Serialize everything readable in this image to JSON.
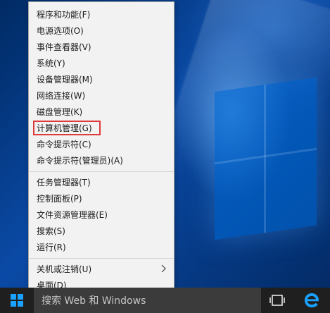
{
  "menu": {
    "items": [
      {
        "label": "程序和功能(F)"
      },
      {
        "label": "电源选项(O)"
      },
      {
        "label": "事件查看器(V)"
      },
      {
        "label": "系统(Y)"
      },
      {
        "label": "设备管理器(M)"
      },
      {
        "label": "网络连接(W)"
      },
      {
        "label": "磁盘管理(K)"
      },
      {
        "label": "计算机管理(G)"
      },
      {
        "label": "命令提示符(C)"
      },
      {
        "label": "命令提示符(管理员)(A)"
      },
      {
        "label": "任务管理器(T)"
      },
      {
        "label": "控制面板(P)"
      },
      {
        "label": "文件资源管理器(E)"
      },
      {
        "label": "搜索(S)"
      },
      {
        "label": "运行(R)"
      },
      {
        "label": "关机或注销(U)"
      },
      {
        "label": "桌面(D)"
      }
    ]
  },
  "taskbar": {
    "search_placeholder": "搜索 Web 和 Windows",
    "icons": {
      "start": "windows-logo-icon",
      "task_view": "task-view-icon",
      "edge": "edge-browser-icon"
    }
  },
  "colors": {
    "menu_background": "#f2f2f2",
    "highlight_border": "#e03a3a",
    "taskbar_background": "#1f1f1f",
    "windows_blue": "#1aa1ff"
  }
}
